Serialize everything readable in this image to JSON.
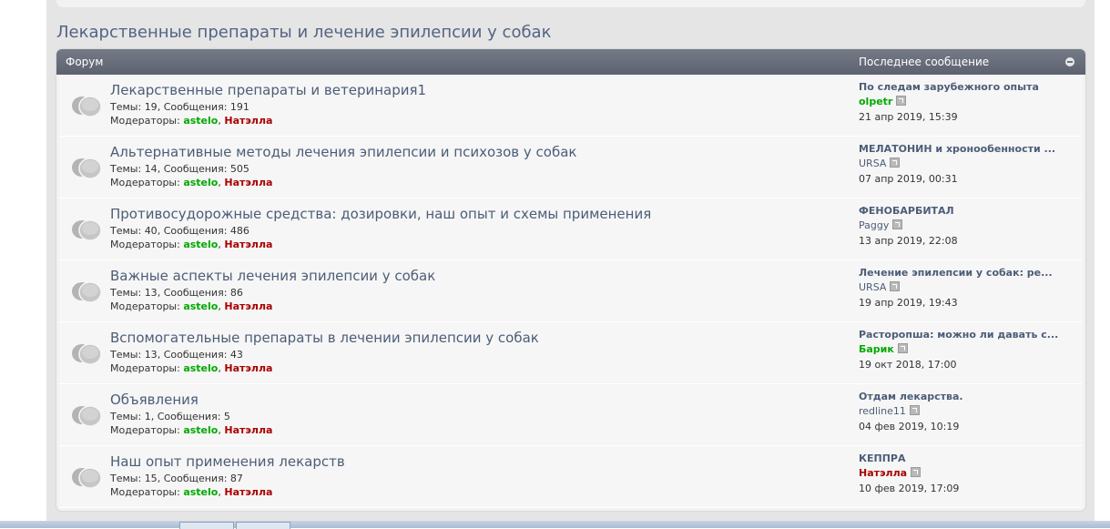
{
  "category": {
    "title": "Лекарственные препараты и лечение эпилепсии у собак"
  },
  "table_header": {
    "forum": "Форум",
    "last_post": "Последнее сообщение"
  },
  "colors": {
    "moderator_1": "#00aa00",
    "moderator_2": "#aa0000",
    "header_bg": "#6a6f7c",
    "link": "#4c5d77"
  },
  "forums": [
    {
      "title": "Лекарственные препараты и ветеринария1",
      "topics_label": "Темы:",
      "topics": "19",
      "posts_label": "Сообщения:",
      "posts": "191",
      "moderators_label": "Модераторы:",
      "moderator_1": "astelo",
      "moderator_2": "Натэлла",
      "last_post_title": "По следам зарубежного опыта",
      "last_post_author": "olpetr",
      "author_style": "green",
      "last_post_date": "21 апр 2019, 15:39"
    },
    {
      "title": "Альтернативные методы лечения эпилепсии и психозов у собак",
      "topics_label": "Темы:",
      "topics": "14",
      "posts_label": "Сообщения:",
      "posts": "505",
      "moderators_label": "Модераторы:",
      "moderator_1": "astelo",
      "moderator_2": "Натэлла",
      "last_post_title": "МЕЛАТОНИН и хронообенности ...",
      "last_post_author": "URSA",
      "author_style": "gray",
      "last_post_date": "07 апр 2019, 00:31"
    },
    {
      "title": "Противосудорожные средства: дозировки, наш опыт и схемы применения",
      "topics_label": "Темы:",
      "topics": "40",
      "posts_label": "Сообщения:",
      "posts": "486",
      "moderators_label": "Модераторы:",
      "moderator_1": "astelo",
      "moderator_2": "Натэлла",
      "last_post_title": "ФЕНОБАРБИТАЛ",
      "last_post_author": "Paggy",
      "author_style": "gray",
      "last_post_date": "13 апр 2019, 22:08"
    },
    {
      "title": "Важные аспекты лечения эпилепсии у собак",
      "topics_label": "Темы:",
      "topics": "13",
      "posts_label": "Сообщения:",
      "posts": "86",
      "moderators_label": "Модераторы:",
      "moderator_1": "astelo",
      "moderator_2": "Натэлла",
      "last_post_title": "Лечение эпилепсии у собак: ре...",
      "last_post_author": "URSA",
      "author_style": "gray",
      "last_post_date": "19 апр 2019, 19:43"
    },
    {
      "title": "Вспомогательные препараты в лечении эпилепсии у собак",
      "topics_label": "Темы:",
      "topics": "13",
      "posts_label": "Сообщения:",
      "posts": "43",
      "moderators_label": "Модераторы:",
      "moderator_1": "astelo",
      "moderator_2": "Натэлла",
      "last_post_title": "Расторопша: можно ли давать с...",
      "last_post_author": "Барик",
      "author_style": "green",
      "last_post_date": "19 окт 2018, 17:00"
    },
    {
      "title": "Объявления",
      "topics_label": "Темы:",
      "topics": "1",
      "posts_label": "Сообщения:",
      "posts": "5",
      "moderators_label": "Модераторы:",
      "moderator_1": "astelo",
      "moderator_2": "Натэлла",
      "last_post_title": "Отдам лекарства.",
      "last_post_author": "redline11",
      "author_style": "gray",
      "last_post_date": "04 фев 2019, 10:19"
    },
    {
      "title": "Наш опыт применения лекарств",
      "topics_label": "Темы:",
      "topics": "15",
      "posts_label": "Сообщения:",
      "posts": "87",
      "moderators_label": "Модераторы:",
      "moderator_1": "astelo",
      "moderator_2": "Натэлла",
      "last_post_title": "КЕППРА",
      "last_post_author": "Натэлла",
      "author_style": "red",
      "last_post_date": "10 фев 2019, 17:09"
    }
  ]
}
